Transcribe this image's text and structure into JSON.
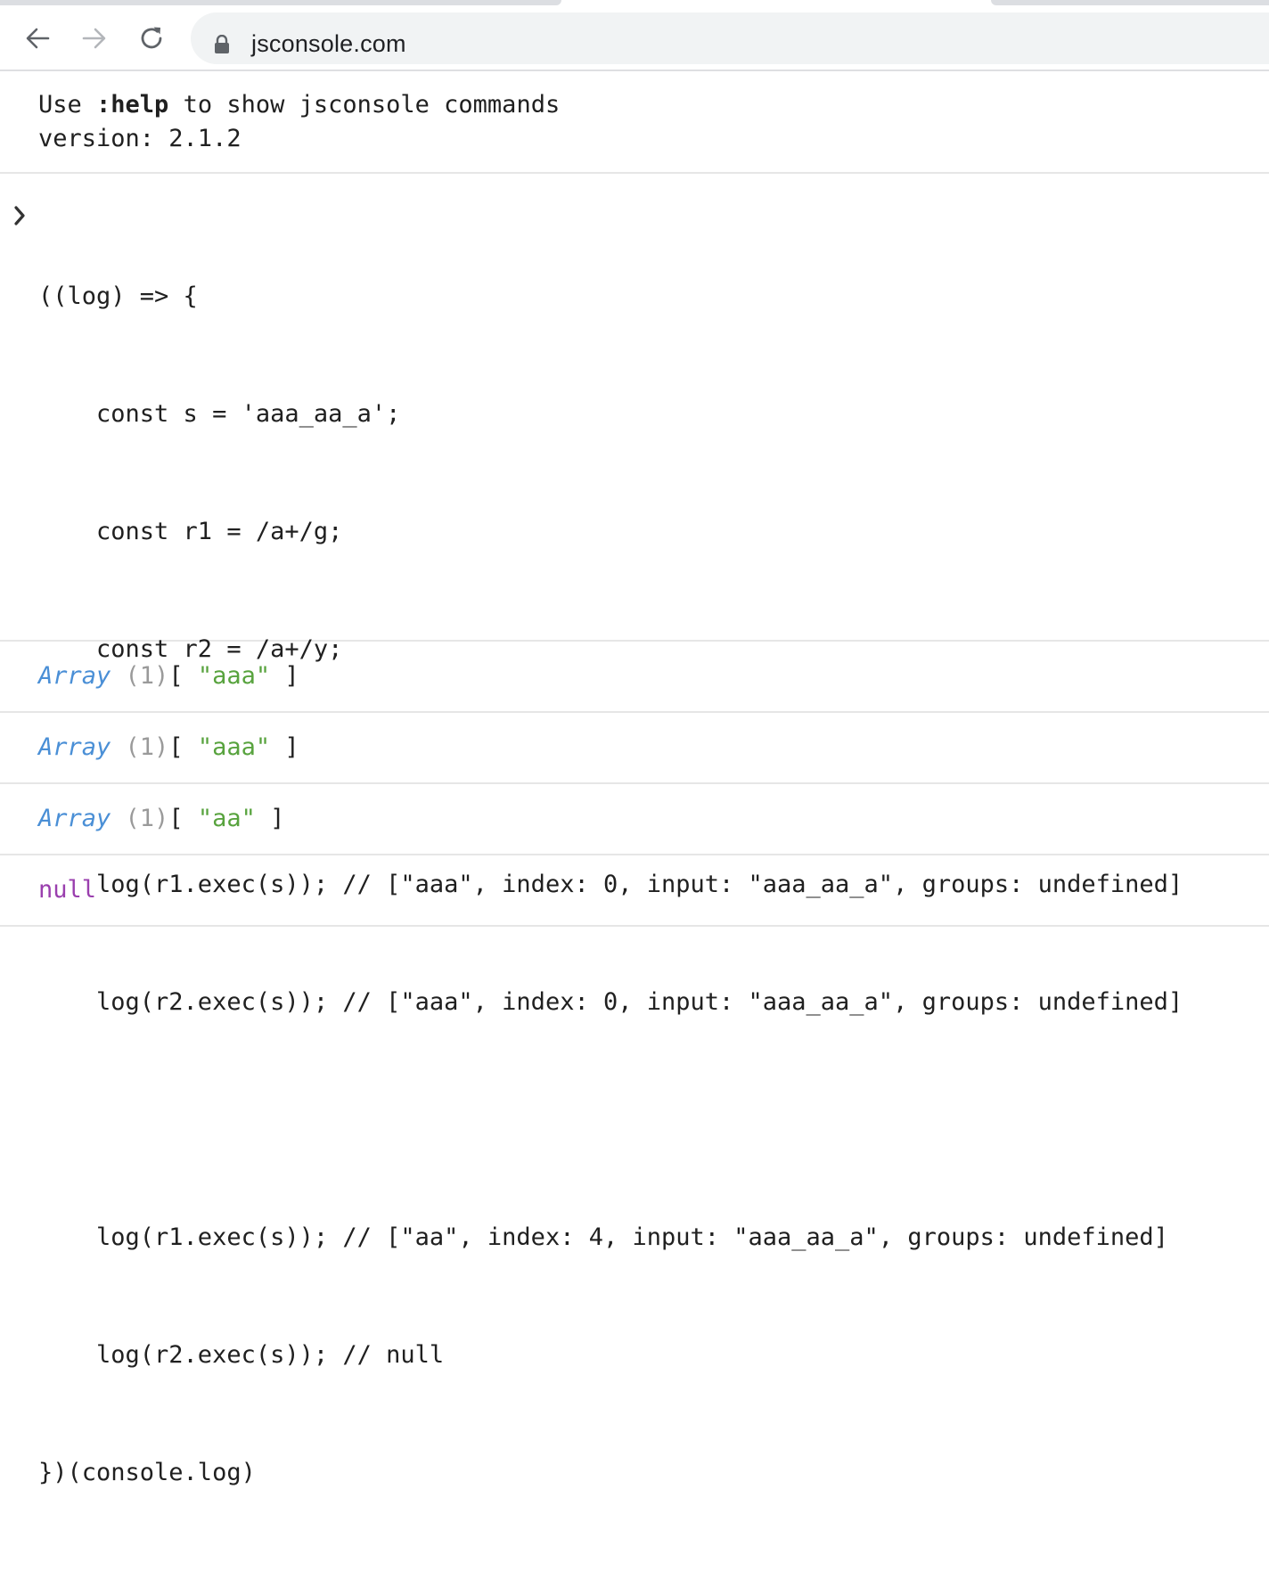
{
  "browser": {
    "url": "jsconsole.com"
  },
  "console": {
    "welcome": {
      "line1_prefix": "Use ",
      "line1_cmd": ":help",
      "line1_suffix": " to show jsconsole commands",
      "line2": "version: 2.1.2"
    },
    "input": {
      "prompt_icon": "chevron-right-icon",
      "lines": [
        "((log) => {",
        "    const s = 'aaa_aa_a';",
        "    const r1 = /a+/g;",
        "    const r2 = /a+/y;",
        "",
        "    log(r1.exec(s)); // [\"aaa\", index: 0, input: \"aaa_aa_a\", groups: undefined]",
        "    log(r2.exec(s)); // [\"aaa\", index: 0, input: \"aaa_aa_a\", groups: undefined]",
        "",
        "    log(r1.exec(s)); // [\"aa\", index: 4, input: \"aaa_aa_a\", groups: undefined]",
        "    log(r2.exec(s)); // null",
        "})(console.log)"
      ]
    },
    "outputs": [
      {
        "type": "Array",
        "count": "(1)",
        "open": "[ ",
        "value": "\"aaa\"",
        "close": " ]"
      },
      {
        "type": "Array",
        "count": "(1)",
        "open": "[ ",
        "value": "\"aaa\"",
        "close": " ]"
      },
      {
        "type": "Array",
        "count": "(1)",
        "open": "[ ",
        "value": "\"aa\"",
        "close": " ]"
      }
    ],
    "null_output": "null"
  },
  "colors": {
    "type": "#4a8fd6",
    "string": "#58a33e",
    "null": "#9a3fae",
    "count": "#9a9a9a"
  }
}
